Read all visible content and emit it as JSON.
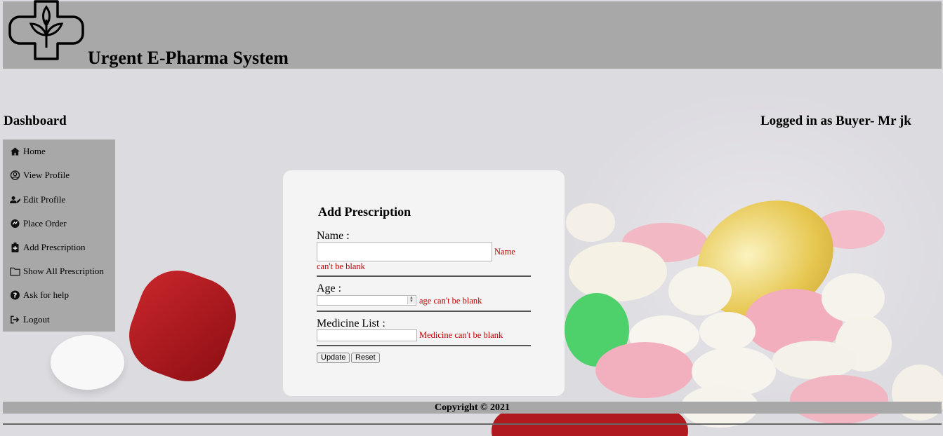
{
  "header": {
    "app_title": "Urgent E-Pharma System"
  },
  "dashboard_title": "Dashboard",
  "logged_in_text": "Logged in as Buyer- Mr jk",
  "sidebar": {
    "items": [
      {
        "label": "Home",
        "icon": "home-icon"
      },
      {
        "label": "View Profile",
        "icon": "user-circle-icon"
      },
      {
        "label": "Edit Profile",
        "icon": "user-edit-icon"
      },
      {
        "label": "Place Order",
        "icon": "comment-icon"
      },
      {
        "label": "Add Prescription",
        "icon": "clipboard-icon"
      },
      {
        "label": "Show All Prescription",
        "icon": "folder-icon"
      },
      {
        "label": "Ask for help",
        "icon": "question-circle-icon"
      },
      {
        "label": "Logout",
        "icon": "sign-out-icon"
      }
    ]
  },
  "form": {
    "title": "Add Prescription",
    "name_label": "Name :",
    "name_value": "",
    "name_error_1": "Name",
    "name_error_2": "can't be blank",
    "age_label": "Age :",
    "age_value": "",
    "age_error": "age can't be blank",
    "medicine_label": "Medicine List :",
    "medicine_value": "",
    "medicine_error": "Medicine can't be blank",
    "update_label": "Update",
    "reset_label": "Reset"
  },
  "footer": {
    "copyright": "Copyright © 2021"
  },
  "colors": {
    "bar_gray": "#a8a8a8",
    "error_red": "#c00000",
    "card_bg": "#f4f4f4"
  }
}
